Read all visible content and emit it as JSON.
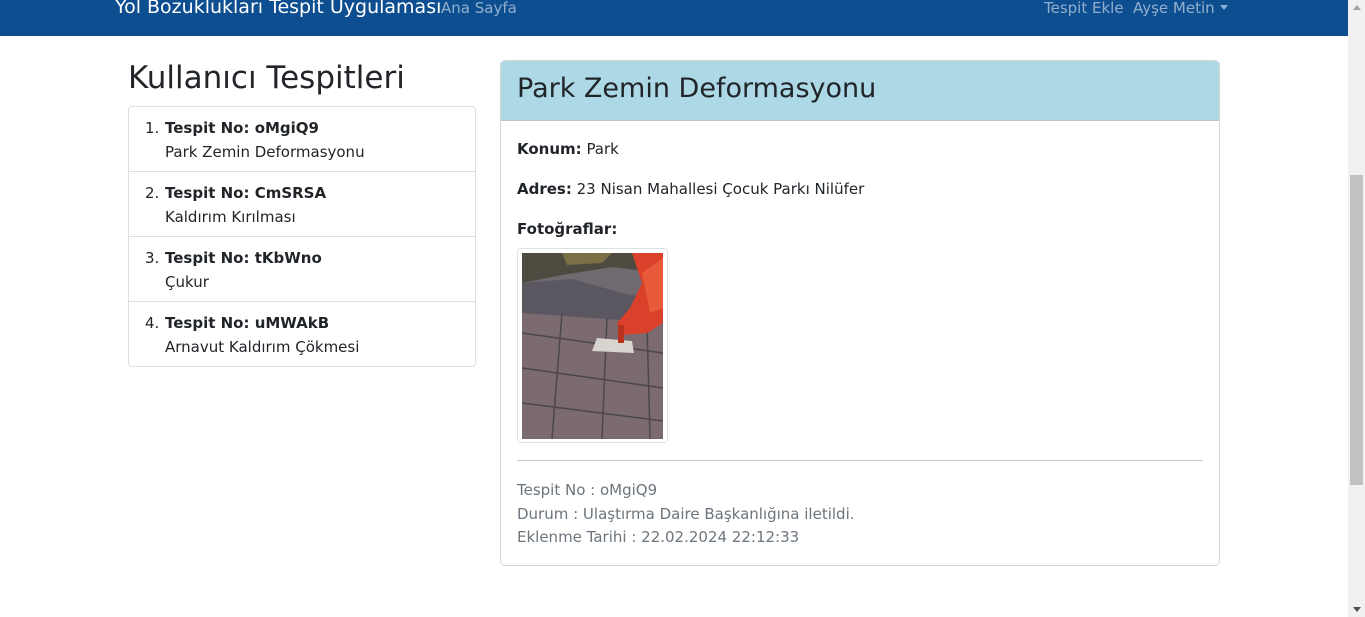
{
  "navbar": {
    "brand": "Yol Bozuklukları Tespit Uygulaması",
    "home_link": "Ana Sayfa",
    "add_link": "Tespit Ekle",
    "user_menu": "Ayşe Metin",
    "background_color": "#0d4e91"
  },
  "sidebar": {
    "title": "Kullanıcı Tespitleri",
    "items": [
      {
        "number": "1.",
        "title": "Tespit No: oMgiQ9",
        "subtitle": "Park Zemin Deformasyonu"
      },
      {
        "number": "2.",
        "title": "Tespit No: CmSRSA",
        "subtitle": "Kaldırım Kırılması"
      },
      {
        "number": "3.",
        "title": "Tespit No: tKbWno",
        "subtitle": "Çukur"
      },
      {
        "number": "4.",
        "title": "Tespit No: uMWAkB",
        "subtitle": "Arnavut Kaldırım Çökmesi"
      }
    ]
  },
  "detail": {
    "title": "Park Zemin Deformasyonu",
    "header_color": "#add8e6",
    "location_label": "Konum:",
    "location_value": "Park",
    "address_label": "Adres:",
    "address_value": "23 Nisan Mahallesi Çocuk Parkı Nilüfer",
    "photos_label": "Fotoğraflar:",
    "tespit_no": "Tespit No : oMgiQ9",
    "status": "Durum : Ulaştırma Daire Başkanlığına iletildi.",
    "created_at": "Eklenme Tarihi : 22.02.2024 22:12:33"
  }
}
